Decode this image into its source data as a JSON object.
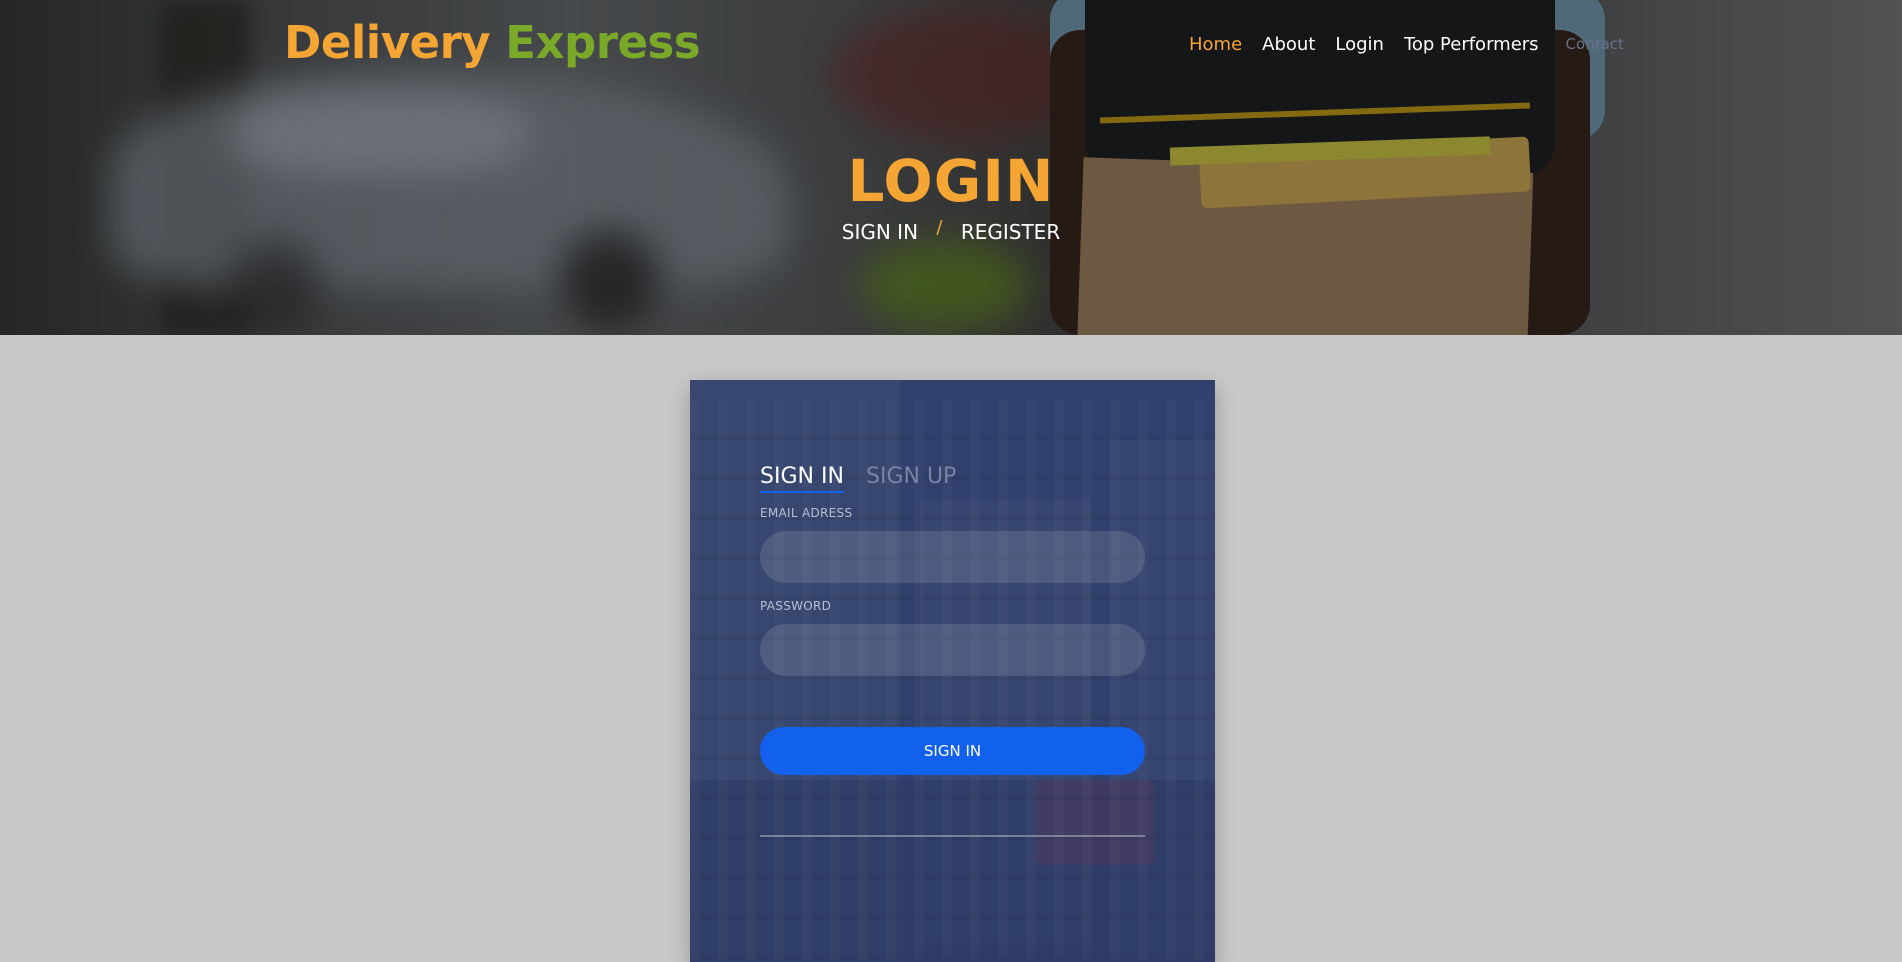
{
  "brand": {
    "part1": "Delivery",
    "part2": "Express",
    "color1": "#f4a534",
    "color2": "#7aa92a"
  },
  "nav": {
    "items": [
      {
        "label": "Home",
        "active": true
      },
      {
        "label": "About"
      },
      {
        "label": "Login"
      },
      {
        "label": "Top Performers"
      },
      {
        "label": "Contact",
        "muted": true
      }
    ]
  },
  "hero": {
    "title": "LOGIN",
    "breadcrumb": {
      "first": "SIGN IN",
      "separator": "/",
      "second": "REGISTER"
    }
  },
  "login_form": {
    "tabs": [
      {
        "label": "SIGN IN",
        "active": true
      },
      {
        "label": "SIGN UP",
        "active": false
      }
    ],
    "email_label": "EMAIL ADRESS",
    "email_value": "",
    "password_label": "PASSWORD",
    "password_value": "",
    "submit_label": "SIGN IN"
  },
  "colors": {
    "accent": "#f4a534",
    "primary_button": "#1161ee",
    "page_background": "#c8c8c8"
  }
}
